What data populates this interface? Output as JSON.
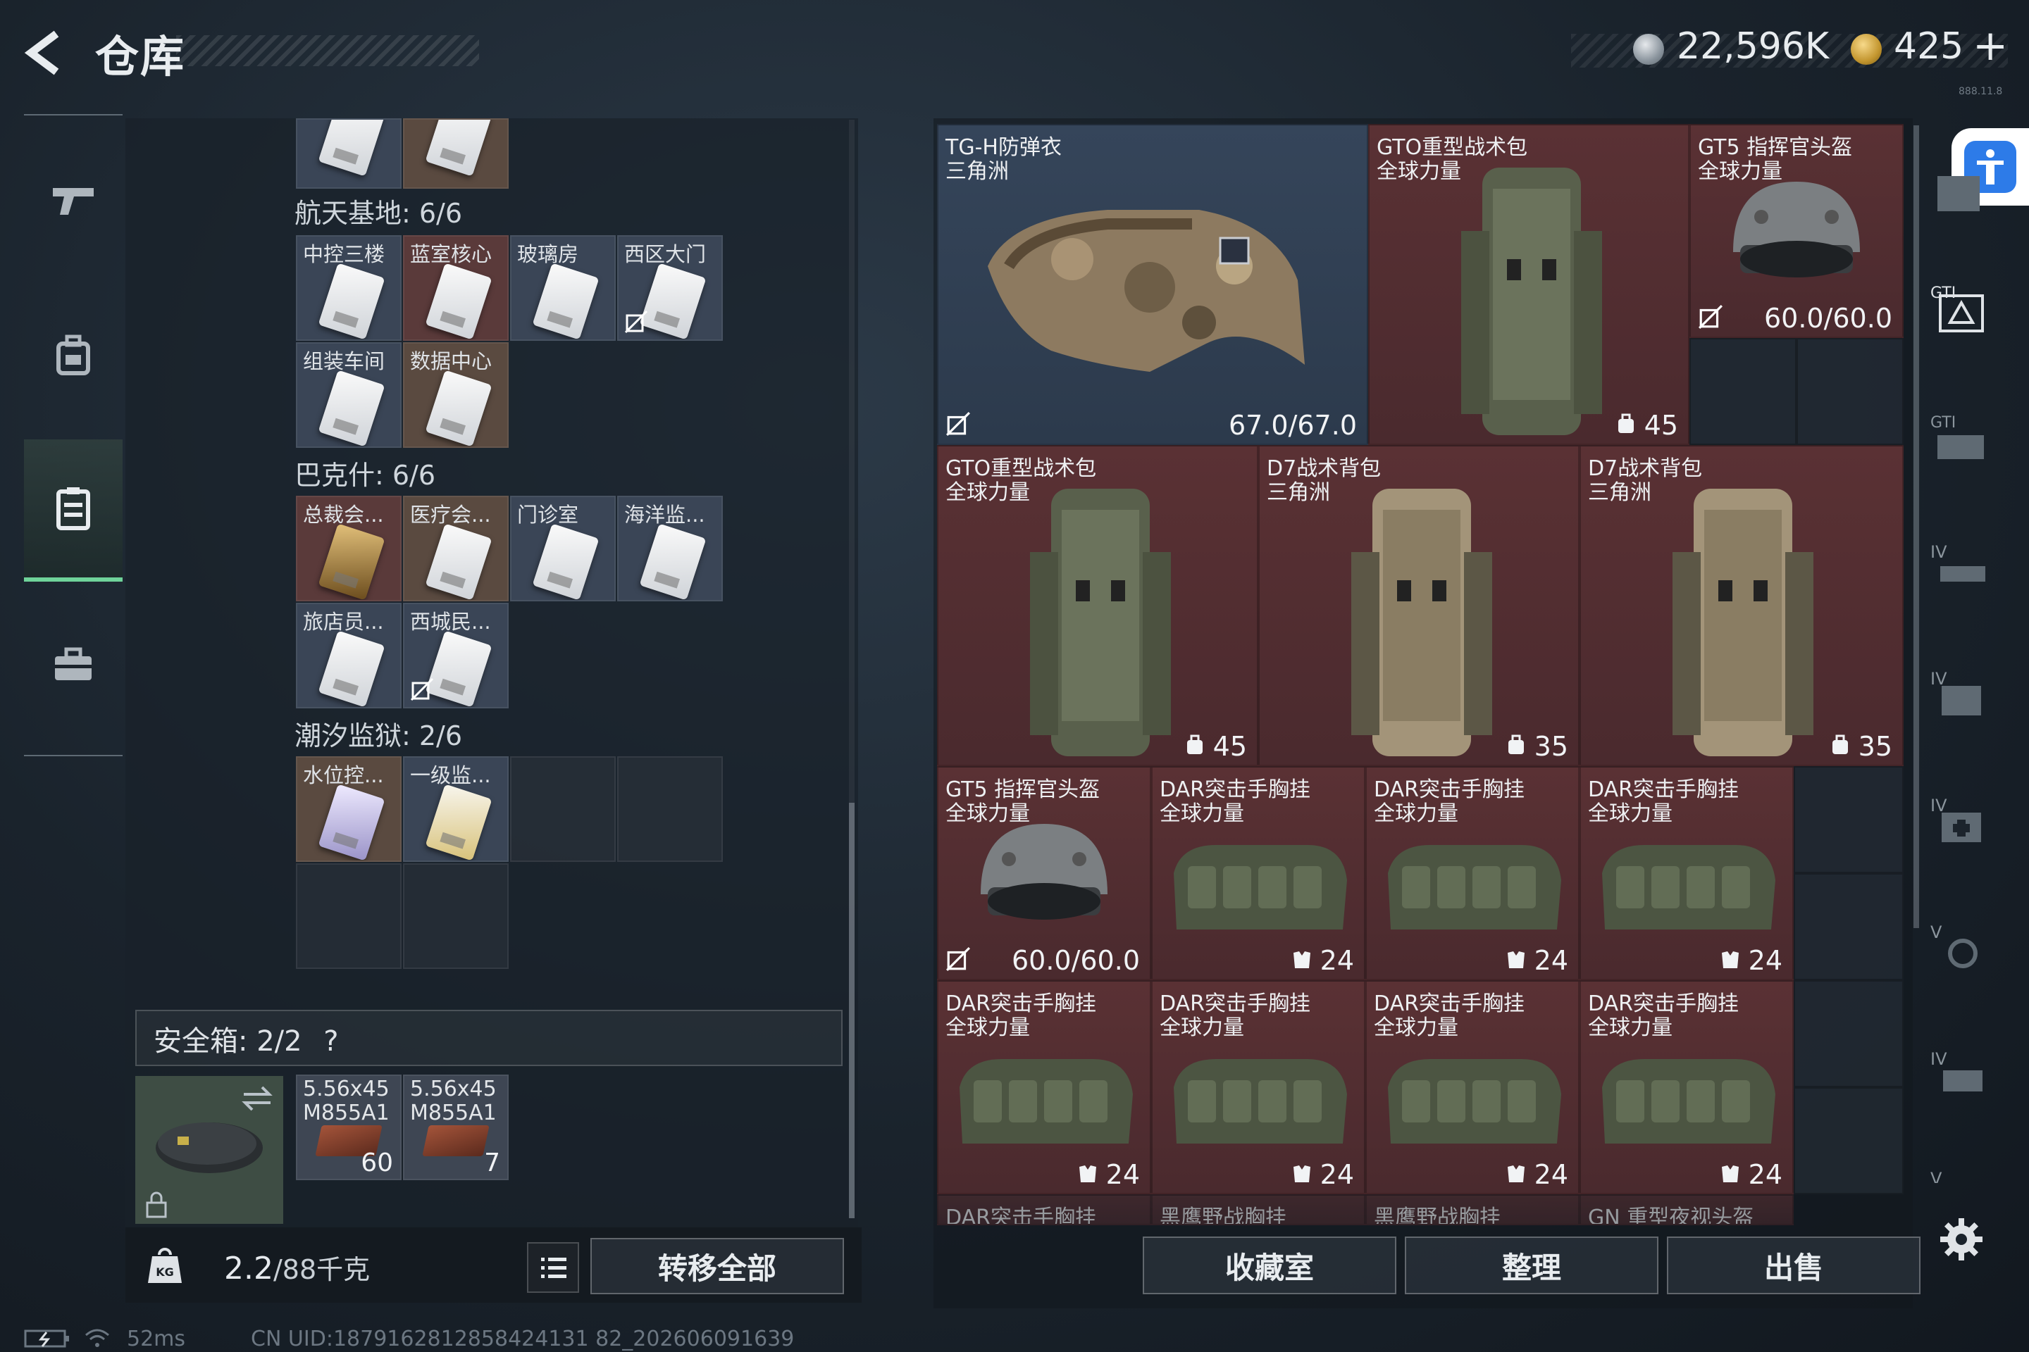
{
  "header": {
    "title": "仓库",
    "currency_primary": "22,596K",
    "currency_secondary": "425",
    "plus_label": "+",
    "version_text": "888.11.8"
  },
  "nav": {
    "items": [
      {
        "name": "weapons",
        "icon": "gun-icon"
      },
      {
        "name": "equipment",
        "icon": "backpack-icon"
      },
      {
        "name": "storage",
        "icon": "locker-icon",
        "active": true
      },
      {
        "name": "briefcase",
        "icon": "briefcase-icon"
      }
    ]
  },
  "keycards": {
    "sections": [
      {
        "title": "航天基地: 6/6",
        "cards": [
          {
            "label": "中控三楼",
            "color": "slate"
          },
          {
            "label": "蓝室核心",
            "color": "red"
          },
          {
            "label": "玻璃房",
            "color": "slate"
          },
          {
            "label": "西区大门",
            "color": "slate",
            "no_trade": true
          },
          {
            "label": "组装车间",
            "color": "slate"
          },
          {
            "label": "数据中心",
            "color": "brown"
          }
        ]
      },
      {
        "title": "巴克什: 6/6",
        "cards": [
          {
            "label": "总裁会...",
            "color": "red",
            "gold": true
          },
          {
            "label": "医疗会...",
            "color": "brown"
          },
          {
            "label": "门诊室",
            "color": "slate"
          },
          {
            "label": "海洋监...",
            "color": "slate"
          },
          {
            "label": "旅店员...",
            "color": "slate"
          },
          {
            "label": "西城民...",
            "color": "slate",
            "no_trade": true
          }
        ]
      },
      {
        "title": "潮汐监狱: 2/6",
        "cards": [
          {
            "label": "水位控...",
            "color": "brown",
            "purple": true
          },
          {
            "label": "一级监...",
            "color": "slate",
            "yellow": true
          }
        ]
      }
    ]
  },
  "safe_box": {
    "label": "安全箱:",
    "count": "2/2",
    "help": "?",
    "ammo": [
      {
        "name1": "5.56x45",
        "name2": "M855A1",
        "count": "60"
      },
      {
        "name1": "5.56x45",
        "name2": "M855A1",
        "count": "7"
      }
    ]
  },
  "bottom_left": {
    "weight": "2.2",
    "weight_max": "/88千克",
    "kg_label": "KG",
    "transfer_all": "转移全部"
  },
  "stash": {
    "items": [
      {
        "name": "TG-H防弹衣",
        "sub": "三角洲",
        "value": "67.0/67.0",
        "color": "slate",
        "no_trade": true,
        "art": "vest"
      },
      {
        "name": "GTO重型战术包",
        "sub": "全球力量",
        "value": "45",
        "color": "red",
        "icon": "backpack-capacity-icon",
        "art": "pack"
      },
      {
        "name": "GT5 指挥官头盔",
        "sub": "全球力量",
        "value": "60.0/60.0",
        "color": "red",
        "no_trade": true,
        "art": "helmet"
      },
      {
        "name": "GTO重型战术包",
        "sub": "全球力量",
        "value": "45",
        "color": "red",
        "icon": "backpack-capacity-icon",
        "art": "pack"
      },
      {
        "name": "D7战术背包",
        "sub": "三角洲",
        "value": "35",
        "color": "red",
        "icon": "backpack-capacity-icon",
        "art": "pack-tan"
      },
      {
        "name": "D7战术背包",
        "sub": "三角洲",
        "value": "35",
        "color": "red",
        "icon": "backpack-capacity-icon",
        "art": "pack-tan"
      },
      {
        "name": "GT5 指挥官头盔",
        "sub": "全球力量",
        "value": "60.0/60.0",
        "color": "red",
        "no_trade": true,
        "art": "helmet"
      },
      {
        "name": "DAR突击手胸挂",
        "sub": "全球力量",
        "value": "24",
        "color": "red",
        "icon": "vest-capacity-icon",
        "art": "rig"
      },
      {
        "name": "DAR突击手胸挂",
        "sub": "全球力量",
        "value": "24",
        "color": "red",
        "icon": "vest-capacity-icon",
        "art": "rig"
      },
      {
        "name": "DAR突击手胸挂",
        "sub": "全球力量",
        "value": "24",
        "color": "red",
        "icon": "vest-capacity-icon",
        "art": "rig"
      },
      {
        "name": "DAR突击手胸挂",
        "sub": "全球力量",
        "value": "24",
        "color": "red",
        "icon": "vest-capacity-icon",
        "art": "rig"
      },
      {
        "name": "DAR突击手胸挂",
        "sub": "全球力量",
        "value": "24",
        "color": "red",
        "icon": "vest-capacity-icon",
        "art": "rig"
      },
      {
        "name": "DAR突击手胸挂",
        "sub": "全球力量",
        "value": "24",
        "color": "red",
        "icon": "vest-capacity-icon",
        "art": "rig"
      },
      {
        "name": "DAR突击手胸挂",
        "sub": "全球力量",
        "value": "24",
        "color": "red",
        "icon": "vest-capacity-icon",
        "art": "rig"
      }
    ],
    "partial_row": [
      "DAR突击手胸挂",
      "黑鹰野战胸挂",
      "黑鹰野战胸挂",
      "GN 重型夜视头盔"
    ]
  },
  "bottom_right": {
    "collection": "收藏室",
    "sort": "整理",
    "sell": "出售"
  },
  "right_sidebar": {
    "badges": [
      "GTI",
      "GTI",
      "IV",
      "IV",
      "IV",
      "V",
      "IV",
      "V"
    ]
  },
  "footer": {
    "ping": "52ms",
    "uid": "CN UID:1879162812858424131 82_202606091639"
  },
  "colors": {
    "accent_green": "#6fd39a",
    "item_red": "#5a3134",
    "item_slate": "#35455a",
    "accessibility_blue": "#2d7be8"
  }
}
